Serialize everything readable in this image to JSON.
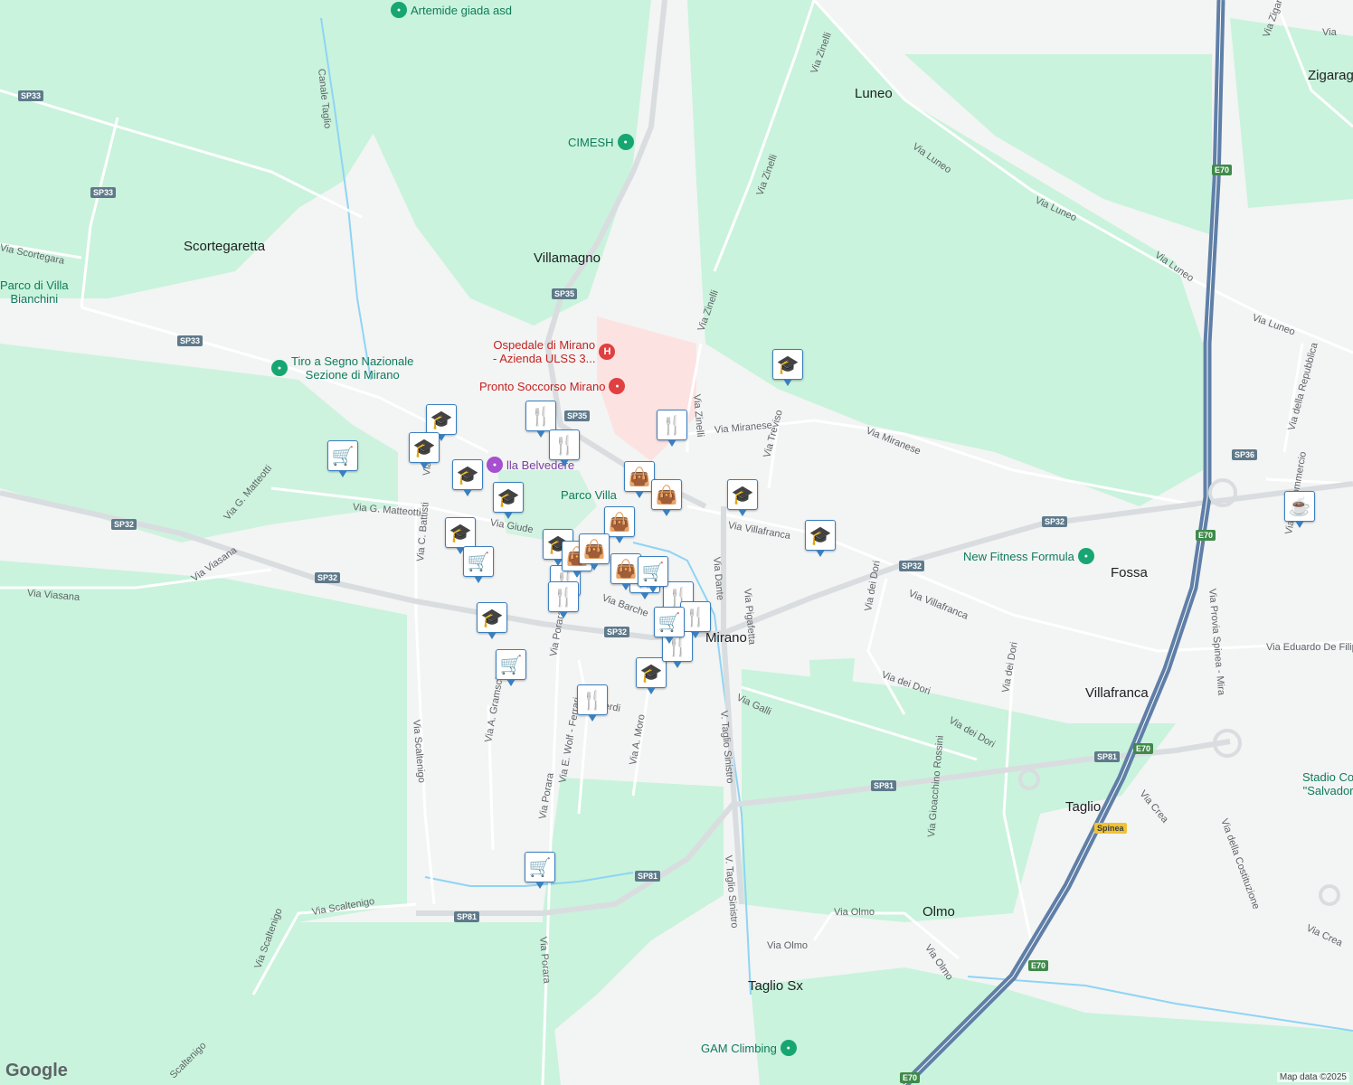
{
  "map": {
    "colors": {
      "background": "#f3f4f4",
      "green": "#c9f3dc",
      "water": "#8fd4f5",
      "road": "#ffffff",
      "highway": "#5f7fa7"
    },
    "towns": [
      {
        "text": "Scortegaretta"
      },
      {
        "text": "Villamagno"
      },
      {
        "text": "Luneo"
      },
      {
        "text": "Zigarag"
      },
      {
        "text": "Fossa"
      },
      {
        "text": "Villafranca"
      },
      {
        "text": "Taglio"
      },
      {
        "text": "Olmo"
      },
      {
        "text": "Taglio Sx"
      },
      {
        "text": "Mirano"
      }
    ],
    "roads": [
      {
        "text": "Canale Taglio"
      },
      {
        "text": "Via Scortegara"
      },
      {
        "text": "Via Zinelli"
      },
      {
        "text": "Via Luneo"
      },
      {
        "text": "Via Luneo"
      },
      {
        "text": "Via Luneo"
      },
      {
        "text": "Via Luneo"
      },
      {
        "text": "Via Zinelli"
      },
      {
        "text": "Via Zinelli"
      },
      {
        "text": "Via Zinelli"
      },
      {
        "text": "Via Miranese"
      },
      {
        "text": "Via Miranese"
      },
      {
        "text": "Via Treviso"
      },
      {
        "text": "Via Villafranca"
      },
      {
        "text": "Via Villafranca"
      },
      {
        "text": "Via Pigafetta"
      },
      {
        "text": "Via Dante"
      },
      {
        "text": "Via G. Matteotti"
      },
      {
        "text": "Via G. Matteotti"
      },
      {
        "text": "Via C. Battisti"
      },
      {
        "text": "Via C. Ba"
      },
      {
        "text": "Via Giude"
      },
      {
        "text": "Via Viasana"
      },
      {
        "text": "Via Viasana"
      },
      {
        "text": "Via Scaltenigo"
      },
      {
        "text": "Via A. Gramsci"
      },
      {
        "text": "Via Porara"
      },
      {
        "text": "Via Porara"
      },
      {
        "text": "Via Porara"
      },
      {
        "text": "Via E. Wolf - Ferrari"
      },
      {
        "text": "Via A. Moro"
      },
      {
        "text": "ppe Verdi"
      },
      {
        "text": "Via Barche"
      },
      {
        "text": "Via Galli"
      },
      {
        "text": "V. Taglio Sinistro"
      },
      {
        "text": "V. Taglio Sinistro"
      },
      {
        "text": "Via dei Dori"
      },
      {
        "text": "Via dei Dori"
      },
      {
        "text": "Via dei Dori"
      },
      {
        "text": "Via dei Dori"
      },
      {
        "text": "Via Gioacchino Rossini"
      },
      {
        "text": "Via Eduardo De Filip"
      },
      {
        "text": "Via Provia Spinea - Mira"
      },
      {
        "text": "Via Crea"
      },
      {
        "text": "Via Crea"
      },
      {
        "text": "Via della Costituzione"
      },
      {
        "text": "Via della Repubblica"
      },
      {
        "text": "Via del Commercio"
      },
      {
        "text": "Via Zigaraga"
      },
      {
        "text": "Via Olmo"
      },
      {
        "text": "Via Olmo"
      },
      {
        "text": "Via Olmo"
      },
      {
        "text": "Via Scaltenigo"
      },
      {
        "text": "Via Scaltenigo"
      },
      {
        "text": "Scaltenigo"
      },
      {
        "text": "Via"
      }
    ],
    "shields": [
      {
        "text": "SP33",
        "kind": "sp"
      },
      {
        "text": "SP33",
        "kind": "sp"
      },
      {
        "text": "SP33",
        "kind": "sp"
      },
      {
        "text": "SP35",
        "kind": "sp"
      },
      {
        "text": "SP35",
        "kind": "sp"
      },
      {
        "text": "SP32",
        "kind": "sp"
      },
      {
        "text": "SP32",
        "kind": "sp"
      },
      {
        "text": "SP32",
        "kind": "sp"
      },
      {
        "text": "SP32",
        "kind": "sp"
      },
      {
        "text": "SP32",
        "kind": "sp"
      },
      {
        "text": "SP36",
        "kind": "sp"
      },
      {
        "text": "SP81",
        "kind": "sp"
      },
      {
        "text": "SP81",
        "kind": "sp"
      },
      {
        "text": "SP81",
        "kind": "sp"
      },
      {
        "text": "SP81",
        "kind": "sp"
      },
      {
        "text": "E70",
        "kind": "e"
      },
      {
        "text": "E70",
        "kind": "e"
      },
      {
        "text": "E70",
        "kind": "e"
      },
      {
        "text": "E70",
        "kind": "e"
      },
      {
        "text": "E70",
        "kind": "e"
      },
      {
        "text": "Spinea",
        "kind": "y"
      }
    ],
    "pois": [
      {
        "text": "Artemide giada asd",
        "color": "green",
        "icon": "leaf-icon"
      },
      {
        "text": "CIMESH",
        "color": "green",
        "icon": "leaf-icon"
      },
      {
        "text": "Ospedale di Mirano",
        "text2": "- Azienda ULSS 3...",
        "color": "red",
        "icon": "hospital-icon"
      },
      {
        "text": "Pronto Soccorso Mirano",
        "color": "red",
        "icon": "pin-icon"
      },
      {
        "text": "Tiro a Segno Nazionale",
        "text2": "Sezione di Mirano",
        "color": "green",
        "icon": "leaf-icon"
      },
      {
        "text": "Parco di Villa",
        "text2": "Bianchini",
        "color": "green",
        "icon": "none"
      },
      {
        "text": "lla Belvedere",
        "color": "purple",
        "icon": "camera-icon"
      },
      {
        "text": "Parco Villa",
        "color": "green",
        "icon": "none"
      },
      {
        "text": "New Fitness Formula",
        "color": "green",
        "icon": "leaf-icon"
      },
      {
        "text": "Stadio Co",
        "text2": "\"Salvador",
        "color": "green",
        "icon": "none"
      },
      {
        "text": "GAM Climbing",
        "color": "green",
        "icon": "leaf-icon"
      }
    ],
    "markers": [
      {
        "icon": "school-icon"
      },
      {
        "icon": "school-icon"
      },
      {
        "icon": "school-icon"
      },
      {
        "icon": "school-icon"
      },
      {
        "icon": "school-icon"
      },
      {
        "icon": "school-icon"
      },
      {
        "icon": "school-icon"
      },
      {
        "icon": "school-icon"
      },
      {
        "icon": "school-icon"
      },
      {
        "icon": "school-icon"
      },
      {
        "icon": "school-icon"
      },
      {
        "icon": "restaurant-icon"
      },
      {
        "icon": "restaurant-icon"
      },
      {
        "icon": "restaurant-icon"
      },
      {
        "icon": "restaurant-icon"
      },
      {
        "icon": "restaurant-icon"
      },
      {
        "icon": "restaurant-icon"
      },
      {
        "icon": "restaurant-icon"
      },
      {
        "icon": "restaurant-icon"
      },
      {
        "icon": "restaurant-icon"
      },
      {
        "icon": "restaurant-icon"
      },
      {
        "icon": "shopping-bag-icon"
      },
      {
        "icon": "shopping-bag-icon"
      },
      {
        "icon": "shopping-bag-icon"
      },
      {
        "icon": "shopping-bag-icon"
      },
      {
        "icon": "shopping-bag-icon"
      },
      {
        "icon": "shopping-bag-icon"
      },
      {
        "icon": "cart-icon"
      },
      {
        "icon": "cart-icon"
      },
      {
        "icon": "cart-icon"
      },
      {
        "icon": "cart-icon"
      },
      {
        "icon": "cart-icon"
      },
      {
        "icon": "cart-icon"
      },
      {
        "icon": "cafe-icon"
      }
    ],
    "logo": "Google",
    "attribution": "Map data ©2025"
  }
}
